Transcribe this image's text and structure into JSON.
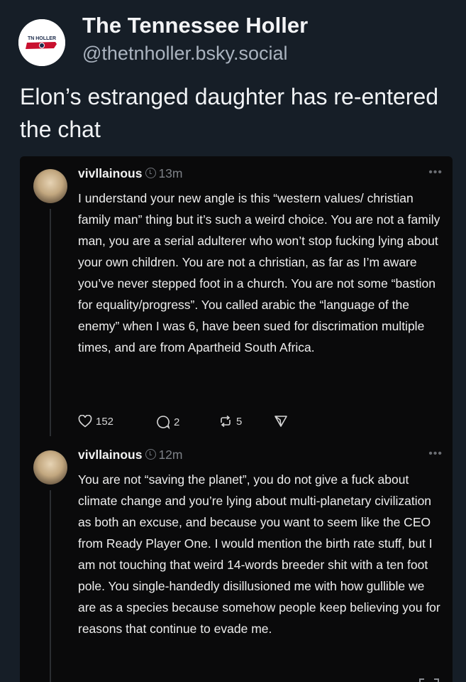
{
  "post": {
    "author_name": "The Tennessee Holler",
    "handle": "@thetnholler.bsky.social",
    "avatar_logo_text": "TN HOLLER",
    "text": "Elon’s estranged daughter has re-entered the chat"
  },
  "embed": {
    "replies": [
      {
        "username": "vivllainous",
        "time": "13m",
        "body": "I understand your new angle is this “western values/ christian family man” thing but it’s such a weird choice. You are not a family man, you are a serial adulterer who won’t stop fucking lying about your own children. You are not a christian, as far as I’m aware you’ve never stepped foot in a church. You are not some “bastion for equality/progress”. You called arabic the “language of the enemy” when I was 6, have been sued for discrimation multiple times, and are from Apartheid South Africa.",
        "likes": "152",
        "comments": "2",
        "reposts": "5"
      },
      {
        "username": "vivllainous",
        "time": "12m",
        "body": "You are not “saving the planet”, you do not give a fuck about climate change and you’re lying about multi-planetary civilization as both an excuse, and because you want to seem like the CEO from Ready Player One. I would mention the birth rate stuff, but I am not touching that weird 14-words breeder shit with a ten foot pole. You single-handedly disillusioned me with how gullible we are as a species because somehow people keep believing you for reasons that continue to evade me."
      }
    ]
  },
  "icons": [
    "heart-icon",
    "comment-icon",
    "repost-icon",
    "share-icon",
    "clock-icon",
    "more-icon"
  ],
  "colors": {
    "background": "#161e27",
    "embed_background": "#0a0a0b",
    "muted_text": "#aab3bf"
  }
}
